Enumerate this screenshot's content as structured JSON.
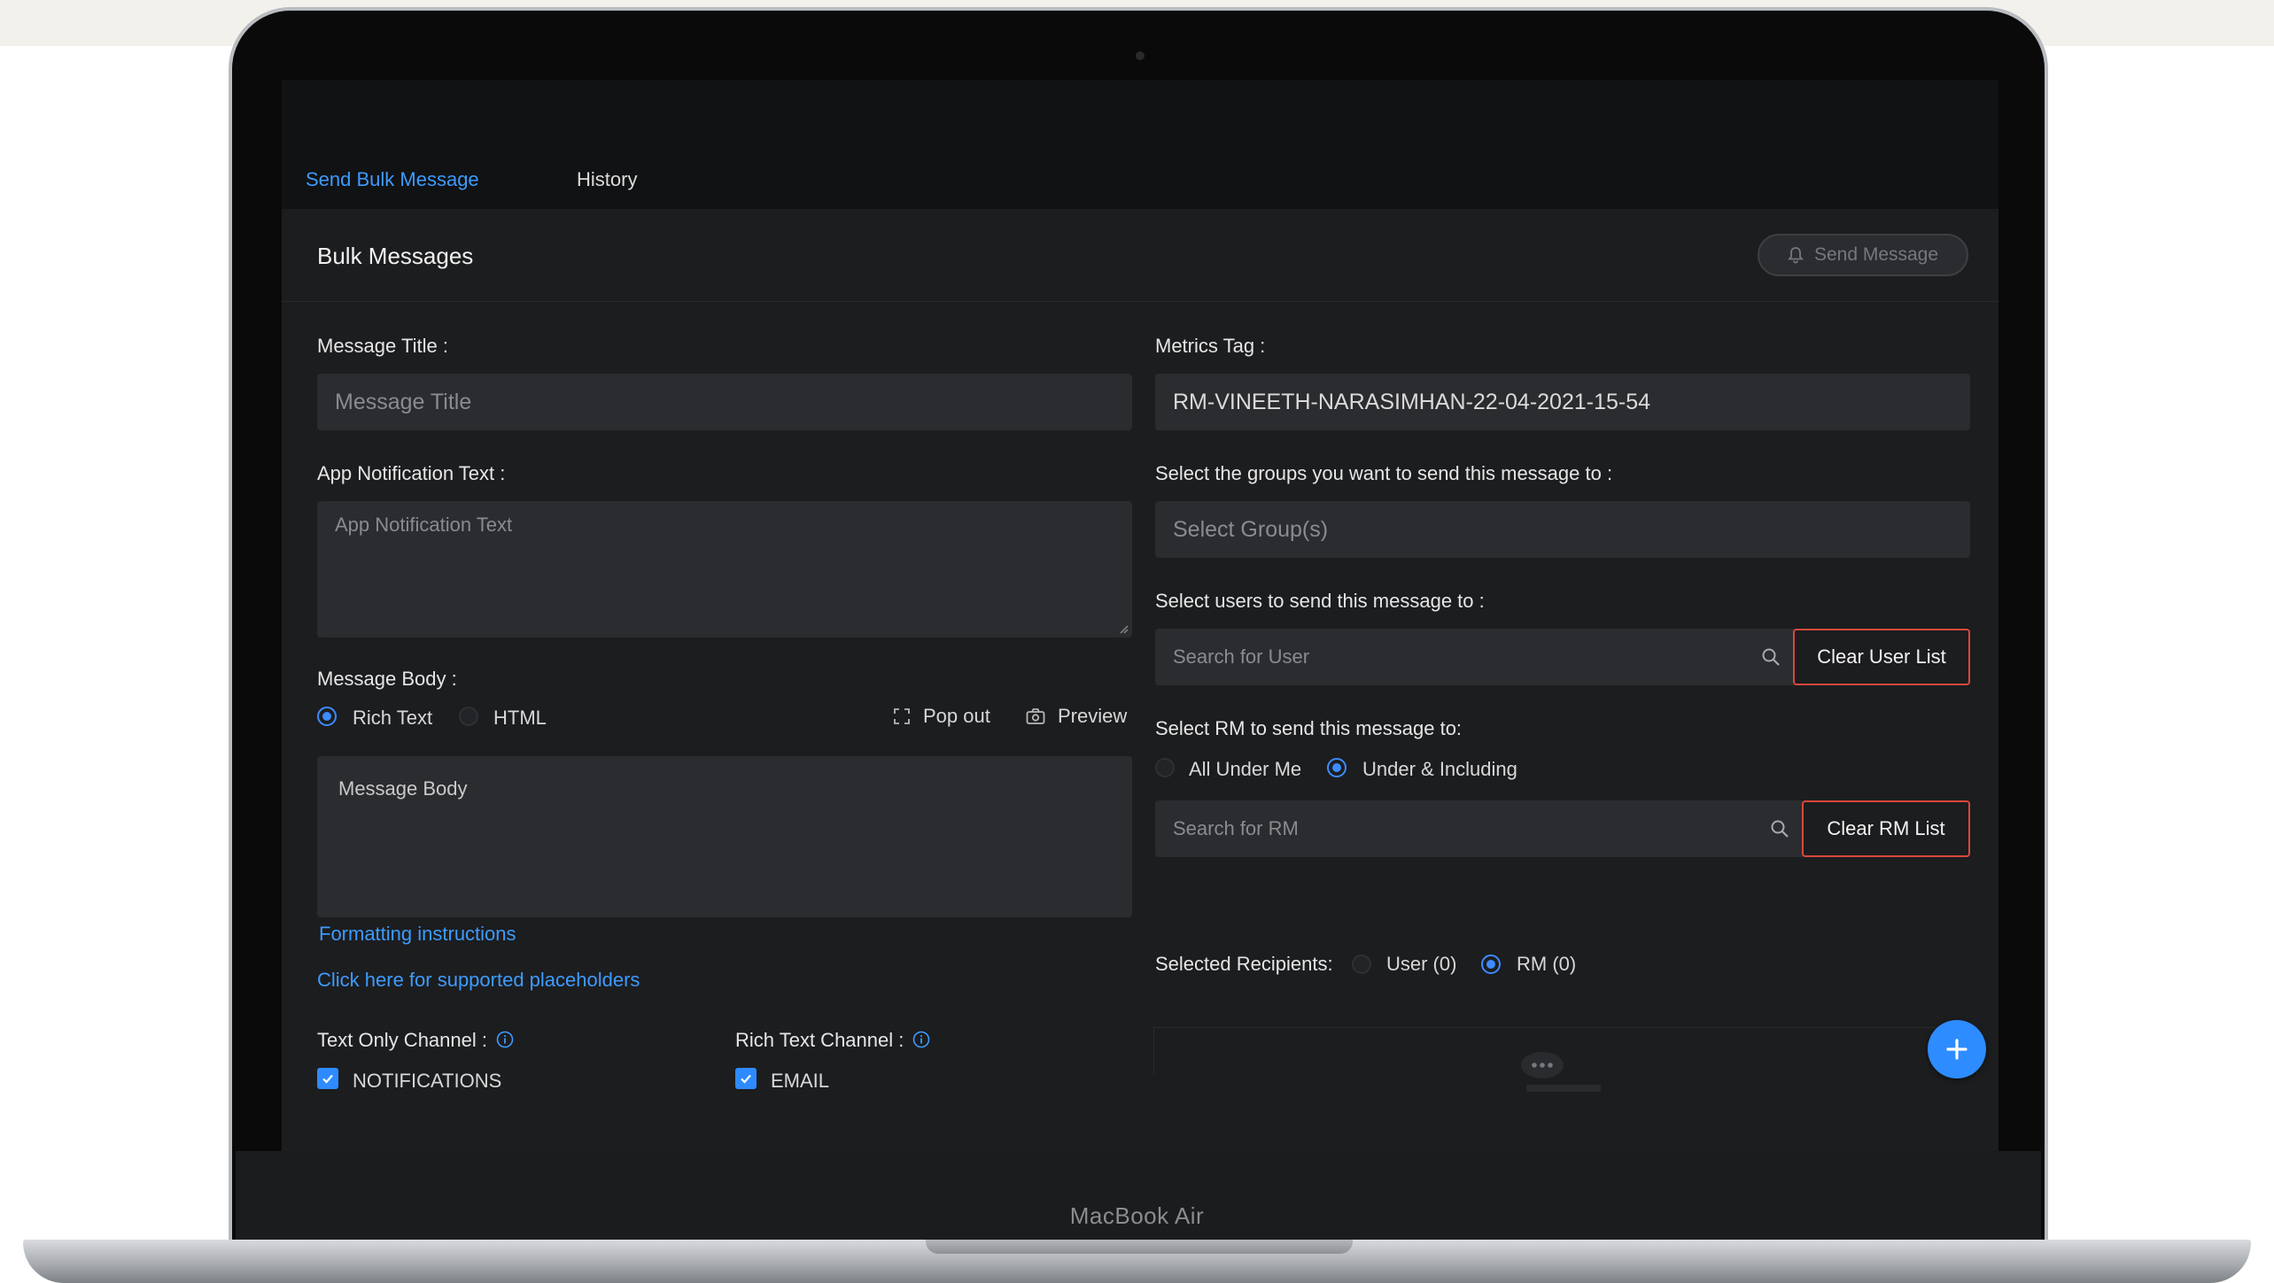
{
  "device": {
    "brand": "MacBook Air"
  },
  "tabs": [
    {
      "label": "Send Bulk Message",
      "active": true
    },
    {
      "label": "History",
      "active": false
    }
  ],
  "panel": {
    "title": "Bulk Messages",
    "send_button": "Send Message"
  },
  "form": {
    "message_title": {
      "label": "Message Title :",
      "placeholder": "Message Title"
    },
    "app_notification": {
      "label": "App Notification Text :",
      "placeholder": "App Notification Text"
    },
    "message_body": {
      "label": "Message Body :",
      "formats": [
        {
          "label": "Rich Text",
          "selected": true
        },
        {
          "label": "HTML",
          "selected": false
        }
      ],
      "pop_out": "Pop out",
      "preview": "Preview",
      "placeholder": "Message Body"
    },
    "formatting_link": "Formatting instructions",
    "placeholders_link": "Click here for supported placeholders",
    "text_only_channel": {
      "label": "Text Only Channel :",
      "option": "NOTIFICATIONS",
      "checked": true
    },
    "rich_text_channel": {
      "label": "Rich Text Channel :",
      "option": "EMAIL",
      "checked": true
    },
    "metrics_tag": {
      "label": "Metrics Tag :",
      "value": "RM-VINEETH-NARASIMHAN-22-04-2021-15-54"
    },
    "groups": {
      "label": "Select the groups you want to send this message to :",
      "placeholder": "Select Group(s)"
    },
    "users": {
      "label": "Select users to send this message to :",
      "placeholder": "Search for User",
      "clear_button": "Clear User List"
    },
    "rm": {
      "label": "Select RM to send this message to:",
      "options": [
        {
          "label": "All Under Me",
          "selected": false
        },
        {
          "label": "Under & Including",
          "selected": true
        }
      ],
      "placeholder": "Search for RM",
      "clear_button": "Clear RM List"
    },
    "recipients": {
      "label": "Selected Recipients:",
      "options": [
        {
          "label": "User (0)",
          "selected": false
        },
        {
          "label": "RM (0)",
          "selected": true
        }
      ]
    }
  },
  "colors": {
    "accent": "#2d8cff",
    "danger": "#d9483b",
    "panel": "#1c1d1f",
    "field": "#2b2c2f"
  }
}
